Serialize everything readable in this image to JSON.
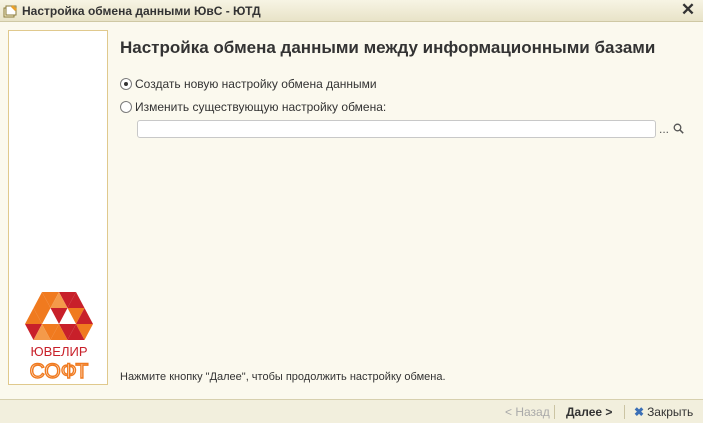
{
  "window": {
    "title": "Настройка обмена данными ЮвС - ЮТД",
    "close_glyph": "✕"
  },
  "sidebar": {
    "logo": {
      "line1": "ЮВЕЛИР",
      "line2": "СОФТ"
    }
  },
  "main": {
    "heading": "Настройка обмена данными между информационными базами",
    "options": [
      {
        "label": "Создать новую настройку обмена данными",
        "selected": true
      },
      {
        "label": "Изменить существующую настройку обмена:",
        "selected": false
      }
    ],
    "existing_setting": {
      "value": "",
      "select_glyph": "...",
      "search_glyph": "🔍"
    },
    "hint": "Нажмите кнопку \"Далее\", чтобы продолжить настройку обмена."
  },
  "footer": {
    "back_label": "< Назад",
    "next_label": "Далее >",
    "close_label": "Закрыть"
  },
  "colors": {
    "background": "#fbf9ee",
    "sidebar_border": "#e0c98d",
    "logo_orange": "#f07a1f",
    "logo_red": "#c8202a",
    "close_x": "#3b6fb6"
  }
}
